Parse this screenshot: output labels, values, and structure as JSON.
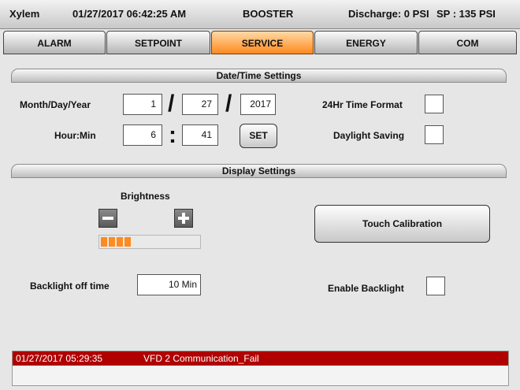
{
  "status_bar": {
    "brand": "Xylem",
    "datetime": "01/27/2017 06:42:25 AM",
    "mode": "BOOSTER",
    "discharge": "Discharge: 0 PSI",
    "setpoint": "SP : 135 PSI"
  },
  "tabs": [
    {
      "label": "ALARM",
      "active": false
    },
    {
      "label": "SETPOINT",
      "active": false
    },
    {
      "label": "SERVICE",
      "active": true
    },
    {
      "label": "ENERGY",
      "active": false
    },
    {
      "label": "COM",
      "active": false
    }
  ],
  "datetime_settings": {
    "title": "Date/Time Settings",
    "date_label": "Month/Day/Year",
    "month": "1",
    "day": "27",
    "year": "2017",
    "date_separator": "/",
    "time_label": "Hour:Min",
    "hour": "6",
    "minute": "41",
    "time_separator": ":",
    "set_button": "SET",
    "format24_label": "24Hr Time Format",
    "format24_checked": false,
    "dst_label": "Daylight Saving",
    "dst_checked": false
  },
  "display_settings": {
    "title": "Display Settings",
    "brightness_label": "Brightness",
    "brightness_level": 4,
    "brightness_max": 16,
    "touch_calibration_button": "Touch Calibration",
    "backlight_label": "Backlight off time",
    "backlight_value": "10 Min",
    "enable_backlight_label": "Enable Backlight",
    "enable_backlight_checked": false
  },
  "alarm": {
    "timestamp": "01/27/2017 05:29:35",
    "message": "VFD 2 Communication_Fail",
    "color": "#b00000"
  },
  "colors": {
    "accent": "#ff8a1f"
  },
  "icons": {
    "decrease": "minus-icon",
    "increase": "plus-icon"
  }
}
